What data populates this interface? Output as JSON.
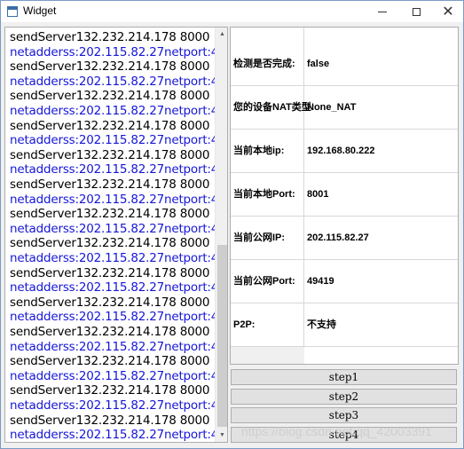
{
  "window": {
    "title": "Widget",
    "icons": {
      "app": "window-app-icon",
      "minimize": "minimize-icon",
      "maximize": "maximize-icon",
      "close": "close-icon"
    }
  },
  "log": {
    "lines": [
      {
        "kind": "send",
        "text": "sendServer132.232.214.178 8000"
      },
      {
        "kind": "net",
        "text": "netadderss:202.115.82.27netport:4"
      },
      {
        "kind": "send",
        "text": "sendServer132.232.214.178 8000"
      },
      {
        "kind": "net",
        "text": "netadderss:202.115.82.27netport:4"
      },
      {
        "kind": "send",
        "text": "sendServer132.232.214.178 8000"
      },
      {
        "kind": "net",
        "text": "netadderss:202.115.82.27netport:4"
      },
      {
        "kind": "send",
        "text": "sendServer132.232.214.178 8000"
      },
      {
        "kind": "net",
        "text": "netadderss:202.115.82.27netport:4"
      },
      {
        "kind": "send",
        "text": "sendServer132.232.214.178 8000"
      },
      {
        "kind": "net",
        "text": "netadderss:202.115.82.27netport:4"
      },
      {
        "kind": "send",
        "text": "sendServer132.232.214.178 8000"
      },
      {
        "kind": "net",
        "text": "netadderss:202.115.82.27netport:4"
      },
      {
        "kind": "send",
        "text": "sendServer132.232.214.178 8000"
      },
      {
        "kind": "net",
        "text": "netadderss:202.115.82.27netport:4"
      },
      {
        "kind": "send",
        "text": "sendServer132.232.214.178 8000"
      },
      {
        "kind": "net",
        "text": "netadderss:202.115.82.27netport:4"
      },
      {
        "kind": "send",
        "text": "sendServer132.232.214.178 8000"
      },
      {
        "kind": "net",
        "text": "netadderss:202.115.82.27netport:4"
      },
      {
        "kind": "send",
        "text": "sendServer132.232.214.178 8000"
      },
      {
        "kind": "net",
        "text": "netadderss:202.115.82.27netport:4"
      },
      {
        "kind": "send",
        "text": "sendServer132.232.214.178 8000"
      },
      {
        "kind": "net",
        "text": "netadderss:202.115.82.27netport:4"
      },
      {
        "kind": "send",
        "text": "sendServer132.232.214.178 8000"
      },
      {
        "kind": "net",
        "text": "netadderss:202.115.82.27netport:4"
      },
      {
        "kind": "send",
        "text": "sendServer132.232.214.178 8000"
      },
      {
        "kind": "net",
        "text": "netadderss:202.115.82.27netport:4"
      },
      {
        "kind": "send",
        "text": "sendServer132.232.214.178 8000"
      },
      {
        "kind": "net",
        "text": "netadderss:202.115.82.27netport:4"
      }
    ],
    "colors": {
      "send": "#000000",
      "net": "#1515d8"
    }
  },
  "info": {
    "rows": [
      {
        "label": "检测是否完成:",
        "value": "false"
      },
      {
        "label": "您的设备NAT类型:",
        "value": "None_NAT"
      },
      {
        "label": "当前本地ip:",
        "value": "192.168.80.222"
      },
      {
        "label": "当前本地Port:",
        "value": "8001"
      },
      {
        "label": "当前公网IP:",
        "value": "202.115.82.27"
      },
      {
        "label": "当前公网Port:",
        "value": "49419"
      },
      {
        "label": "P2P:",
        "value": "不支持"
      }
    ]
  },
  "buttons": [
    "step1",
    "step2",
    "step3",
    "step4"
  ],
  "watermark": "https://blog.csdn.net/qq_42003391"
}
